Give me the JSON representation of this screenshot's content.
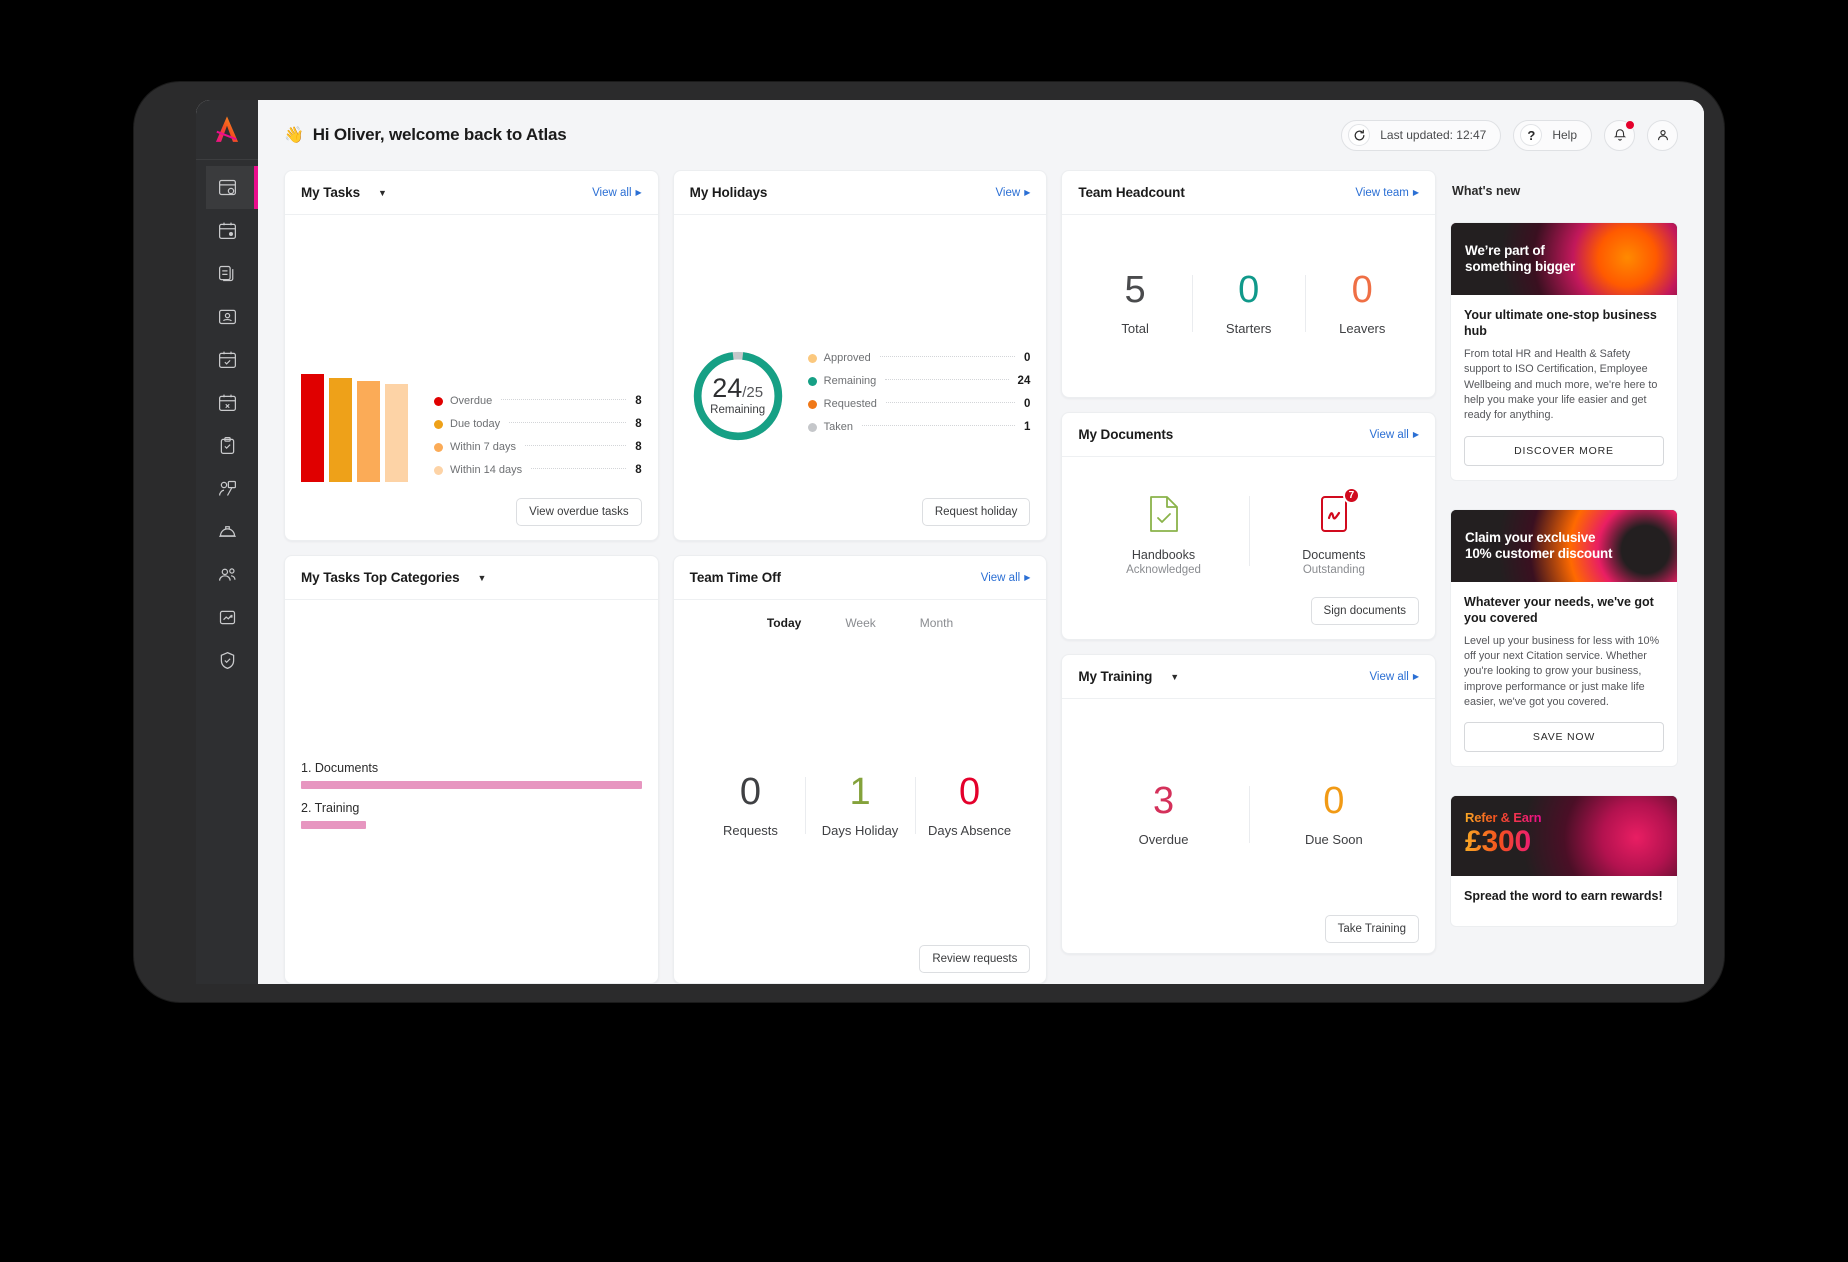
{
  "app": {
    "name": "Atlas",
    "logo_icon": "atlas-a-logo"
  },
  "topbar": {
    "greeting": "Hi Oliver, welcome back to Atlas",
    "wave_icon": "waving-hand-icon",
    "refresh_icon": "refresh-icon",
    "last_updated": "Last updated: 12:47",
    "help_icon": "question-mark-icon",
    "help_label": "Help",
    "bell_icon": "bell-notification-icon",
    "account_icon": "user-account-icon"
  },
  "sidebar": {
    "items": [
      {
        "name": "dashboard",
        "icon": "dashboard-icon",
        "active": true
      },
      {
        "name": "calendar",
        "icon": "calendar-icon",
        "active": false
      },
      {
        "name": "documents",
        "icon": "documents-copy-icon",
        "active": false
      },
      {
        "name": "employees",
        "icon": "id-card-icon",
        "active": false
      },
      {
        "name": "holidays",
        "icon": "calendar-check-icon",
        "active": false
      },
      {
        "name": "absence",
        "icon": "calendar-cross-icon",
        "active": false
      },
      {
        "name": "tasks",
        "icon": "clipboard-check-icon",
        "active": false
      },
      {
        "name": "recruitment",
        "icon": "person-badge-icon",
        "active": false
      },
      {
        "name": "health-safety",
        "icon": "hard-hat-icon",
        "active": false
      },
      {
        "name": "teams",
        "icon": "people-icon",
        "active": false
      },
      {
        "name": "reports",
        "icon": "chart-trend-icon",
        "active": false
      },
      {
        "name": "compliance",
        "icon": "shield-check-icon",
        "active": false
      }
    ]
  },
  "my_tasks": {
    "title": "My Tasks",
    "view_all": "View all",
    "button": "View overdue tasks",
    "chart_data": {
      "type": "bar",
      "title": "My Tasks",
      "categories": [
        "Overdue",
        "Due today",
        "Within 7 days",
        "Within 14 days"
      ],
      "values": [
        8,
        8,
        8,
        8
      ],
      "colors": [
        "#e00000",
        "#eea119",
        "#fbab57",
        "#fdd3a6"
      ],
      "xlabel": "",
      "ylabel": "",
      "ylim": [
        0,
        8
      ],
      "legend": [
        {
          "label": "Overdue",
          "value": "8",
          "color": "#e00000"
        },
        {
          "label": "Due today",
          "value": "8",
          "color": "#eea119"
        },
        {
          "label": "Within 7 days",
          "value": "8",
          "color": "#fbab57"
        },
        {
          "label": "Within 14 days",
          "value": "8",
          "color": "#fdd3a6"
        }
      ]
    }
  },
  "my_holidays": {
    "title": "My Holidays",
    "view": "View",
    "button": "Request holiday",
    "center_value": "24",
    "center_total": "/25",
    "center_label": "Remaining",
    "chart_data": {
      "type": "pie",
      "title": "My Holidays",
      "categories": [
        "Approved",
        "Remaining",
        "Requested",
        "Taken"
      ],
      "values": [
        0,
        24,
        0,
        1
      ],
      "colors": [
        "#fbc87e",
        "#16a085",
        "#f07818",
        "#c5c7ca"
      ],
      "total": 25,
      "legend": [
        {
          "label": "Approved",
          "value": "0",
          "color": "#fbc87e"
        },
        {
          "label": "Remaining",
          "value": "24",
          "color": "#16a085"
        },
        {
          "label": "Requested",
          "value": "0",
          "color": "#f07818"
        },
        {
          "label": "Taken",
          "value": "1",
          "color": "#c5c7ca"
        }
      ]
    }
  },
  "team_headcount": {
    "title": "Team Headcount",
    "view_team": "View team",
    "stats": [
      {
        "value": "5",
        "label": "Total",
        "color": "#4a4b4d"
      },
      {
        "value": "0",
        "label": "Starters",
        "color": "#10998a"
      },
      {
        "value": "0",
        "label": "Leavers",
        "color": "#ef6f45"
      }
    ]
  },
  "my_documents": {
    "title": "My Documents",
    "view_all": "View all",
    "button": "Sign documents",
    "items": [
      {
        "icon": "document-check-icon",
        "title": "Handbooks",
        "subtitle": "Acknowledged",
        "badge": ""
      },
      {
        "icon": "document-signature-icon",
        "title": "Documents",
        "subtitle": "Outstanding",
        "badge": "7"
      }
    ]
  },
  "my_training": {
    "title": "My Training",
    "view_all": "View all",
    "button": "Take Training",
    "stats": [
      {
        "value": "3",
        "label": "Overdue",
        "color": "#d4305a"
      },
      {
        "value": "0",
        "label": "Due Soon",
        "color": "#f19a15"
      }
    ]
  },
  "top_categories": {
    "title": "My Tasks Top Categories",
    "chart_data": {
      "type": "bar",
      "title": "My Tasks Top Categories",
      "orientation": "horizontal",
      "categories": [
        "1. Documents",
        "2. Training"
      ],
      "values": [
        100,
        19
      ],
      "bar_color": "#e796c0",
      "xlabel": "",
      "ylabel": ""
    }
  },
  "team_time_off": {
    "title": "Team Time Off",
    "view_all": "View all",
    "button": "Review requests",
    "tabs": [
      {
        "label": "Today",
        "active": true
      },
      {
        "label": "Week",
        "active": false
      },
      {
        "label": "Month",
        "active": false
      }
    ],
    "stats": [
      {
        "value": "0",
        "label": "Requests",
        "color": "#3f4043"
      },
      {
        "value": "1",
        "label": "Days Holiday",
        "color": "#84a23b"
      },
      {
        "value": "0",
        "label": "Days Absence",
        "color": "#e4002b"
      }
    ]
  },
  "whats_new": {
    "title": "What's new",
    "cards": [
      {
        "banner_text": "We're part of\nsomething bigger",
        "heading": "Your ultimate one-stop business hub",
        "body": "From total HR and Health & Safety support to ISO Certification, Employee Wellbeing and much more, we're here to help you make your life easier and get ready for anything.",
        "button": "DISCOVER MORE"
      },
      {
        "banner_text": "Claim your exclusive\n10% customer discount",
        "heading": "Whatever your needs, we've got you covered",
        "body": "Level up your business for less with 10% off your next Citation service. Whether you're looking to grow your business, improve performance or just make life easier, we've got you covered.",
        "button": "SAVE NOW"
      },
      {
        "banner_text": "Refer & Earn",
        "banner_amount": "£300",
        "heading": "Spread the word to earn rewards!",
        "body": "",
        "button": ""
      }
    ]
  },
  "colors": {
    "accent_pink": "#ec0c8d",
    "link_blue": "#2b6fd4",
    "teal": "#16a085",
    "red": "#e00000",
    "page_bg": "#f4f5f7"
  }
}
